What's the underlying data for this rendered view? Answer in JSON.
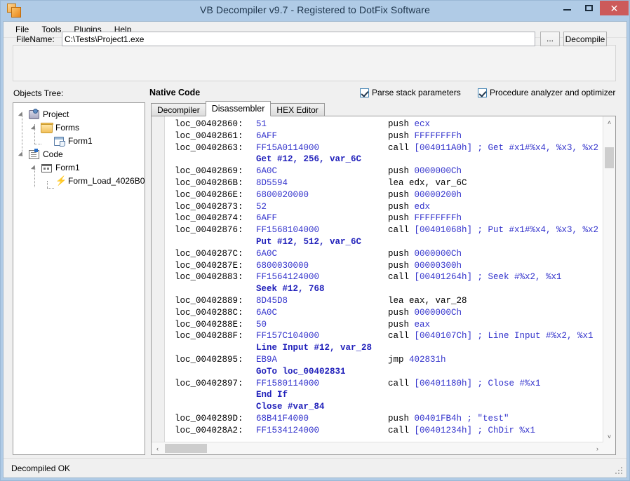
{
  "window": {
    "title": "VB Decompiler v9.7 - Registered to DotFix Software",
    "app_icon": "vb-decompiler-icon",
    "minimize_label": "Minimize",
    "maximize_label": "Maximize",
    "close_label": "Close",
    "titlebar_color": "#b0cbe6",
    "close_button_color": "#cc5a5a"
  },
  "menu": {
    "items": [
      {
        "label": "File"
      },
      {
        "label": "Tools"
      },
      {
        "label": "Plugins"
      },
      {
        "label": "Help"
      }
    ]
  },
  "toolbar": {
    "filename_label": "FileName:",
    "filename_value": "C:\\Tests\\Project1.exe",
    "filename_placeholder": "",
    "browse_label": "...",
    "decompile_label": "Decompile"
  },
  "panels": {
    "objects_tree_label": "Objects Tree:",
    "native_code_label": "Native Code"
  },
  "options": {
    "parse_stack": {
      "label": "Parse stack parameters",
      "checked": true
    },
    "analyzer": {
      "label": "Procedure analyzer and optimizer",
      "checked": true
    }
  },
  "tree": {
    "nodes": [
      {
        "label": "Project",
        "icon": "project-icon",
        "depth": 0,
        "expanded": true
      },
      {
        "label": "Forms",
        "icon": "folder-icon",
        "depth": 1,
        "expanded": true
      },
      {
        "label": "Form1",
        "icon": "form-icon",
        "depth": 2,
        "expanded": false
      },
      {
        "label": "Code",
        "icon": "code-icon",
        "depth": 0,
        "expanded": true
      },
      {
        "label": "Form1",
        "icon": "module-icon",
        "depth": 1,
        "expanded": true
      },
      {
        "label": "Form_Load_4026B0",
        "icon": "procedure-icon",
        "depth": 2,
        "expanded": false
      }
    ]
  },
  "tabs": {
    "items": [
      {
        "label": "Decompiler",
        "active": false
      },
      {
        "label": "Disassembler",
        "active": true
      },
      {
        "label": "HEX Editor",
        "active": false
      }
    ]
  },
  "code": {
    "lines": [
      {
        "type": "asm",
        "addr": "loc_00402860:",
        "bytes": "51",
        "mnem": "push ",
        "op": "ecx"
      },
      {
        "type": "asm",
        "addr": "loc_00402861:",
        "bytes": "6AFF",
        "mnem": "push ",
        "op": "FFFFFFFFh"
      },
      {
        "type": "asm",
        "addr": "loc_00402863:",
        "bytes": "FF15A0114000",
        "mnem": "call ",
        "op": "[004011A0h] ; Get #x1#%x4, %x3, %x2"
      },
      {
        "type": "interp",
        "text": "Get #12, 256, var_6C"
      },
      {
        "type": "asm",
        "addr": "loc_00402869:",
        "bytes": "6A0C",
        "mnem": "push ",
        "op": "0000000Ch"
      },
      {
        "type": "asm",
        "addr": "loc_0040286B:",
        "bytes": "8D5594",
        "mnem": "lea edx, var_6C",
        "op": ""
      },
      {
        "type": "asm",
        "addr": "loc_0040286E:",
        "bytes": "6800020000",
        "mnem": "push ",
        "op": "00000200h"
      },
      {
        "type": "asm",
        "addr": "loc_00402873:",
        "bytes": "52",
        "mnem": "push ",
        "op": "edx"
      },
      {
        "type": "asm",
        "addr": "loc_00402874:",
        "bytes": "6AFF",
        "mnem": "push ",
        "op": "FFFFFFFFh"
      },
      {
        "type": "asm",
        "addr": "loc_00402876:",
        "bytes": "FF1568104000",
        "mnem": "call ",
        "op": "[00401068h] ; Put #x1#%x4, %x3, %x2"
      },
      {
        "type": "interp",
        "text": "Put #12, 512, var_6C"
      },
      {
        "type": "asm",
        "addr": "loc_0040287C:",
        "bytes": "6A0C",
        "mnem": "push ",
        "op": "0000000Ch"
      },
      {
        "type": "asm",
        "addr": "loc_0040287E:",
        "bytes": "6800030000",
        "mnem": "push ",
        "op": "00000300h"
      },
      {
        "type": "asm",
        "addr": "loc_00402883:",
        "bytes": "FF1564124000",
        "mnem": "call ",
        "op": "[00401264h] ; Seek #%x2, %x1"
      },
      {
        "type": "interp",
        "text": "Seek #12, 768"
      },
      {
        "type": "asm",
        "addr": "loc_00402889:",
        "bytes": "8D45D8",
        "mnem": "lea eax, var_28",
        "op": ""
      },
      {
        "type": "asm",
        "addr": "loc_0040288C:",
        "bytes": "6A0C",
        "mnem": "push ",
        "op": "0000000Ch"
      },
      {
        "type": "asm",
        "addr": "loc_0040288E:",
        "bytes": "50",
        "mnem": "push ",
        "op": "eax"
      },
      {
        "type": "asm",
        "addr": "loc_0040288F:",
        "bytes": "FF157C104000",
        "mnem": "call ",
        "op": "[0040107Ch] ; Line Input #%x2, %x1"
      },
      {
        "type": "interp",
        "text": "Line Input #12, var_28"
      },
      {
        "type": "asm",
        "addr": "loc_00402895:",
        "bytes": "EB9A",
        "mnem": "jmp ",
        "op": "402831h"
      },
      {
        "type": "interp",
        "text": "GoTo loc_00402831"
      },
      {
        "type": "asm",
        "addr": "loc_00402897:",
        "bytes": "FF1580114000",
        "mnem": "call ",
        "op": "[00401180h] ; Close #%x1"
      },
      {
        "type": "interp",
        "text": "End If"
      },
      {
        "type": "interp",
        "text": "Close #var_84"
      },
      {
        "type": "asm",
        "addr": "loc_0040289D:",
        "bytes": "68B41F4000",
        "mnem": "push ",
        "op": "00401FB4h ; \"test\""
      },
      {
        "type": "asm",
        "addr": "loc_004028A2:",
        "bytes": "FF1534124000",
        "mnem": "call ",
        "op": "[00401234h] ; ChDir %x1"
      }
    ]
  },
  "scrollbars": {
    "up_arrow": "˄",
    "down_arrow": "˅",
    "left_arrow": "‹",
    "right_arrow": "›"
  },
  "status": {
    "text": "Decompiled OK"
  }
}
